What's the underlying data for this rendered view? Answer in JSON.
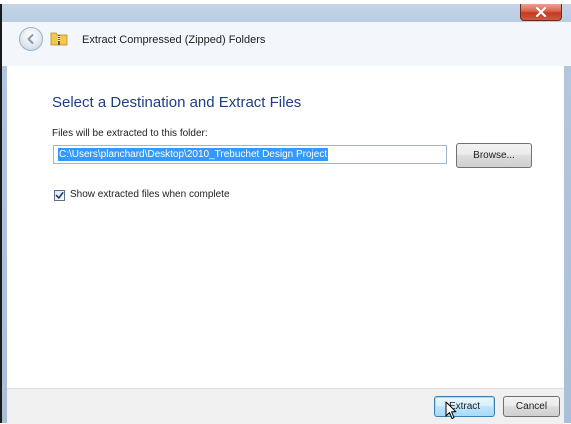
{
  "window": {
    "title": "Extract Compressed (Zipped) Folders"
  },
  "titlebar": {
    "back_icon": "back-arrow-icon",
    "folder_icon": "zip-folder-icon",
    "close_icon": "close-icon"
  },
  "main": {
    "heading": "Select a Destination and Extract Files",
    "path_label": "Files will be extracted to this folder:",
    "path_value": "C:\\Users\\planchard\\Desktop\\2010_Trebuchet Design Project",
    "browse_label": "Browse...",
    "show_files_label": "Show extracted files when complete",
    "show_files_checked": true
  },
  "footer": {
    "extract_label": "Extract",
    "cancel_label": "Cancel"
  },
  "colors": {
    "heading": "#1e3d8a",
    "selection": "#3399ff",
    "close_button": "#c33a21"
  }
}
